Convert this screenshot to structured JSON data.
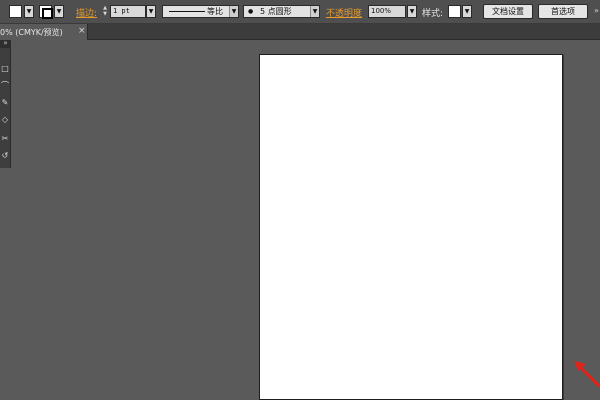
{
  "control_bar": {
    "fill_swatch_color": "#ffffff",
    "stroke_swatch_color": "#ffffff",
    "stroke_label": "描边:",
    "stroke_weight_value": "1 pt",
    "stroke_profile_label": "等比",
    "brush_value": "5 点圆形",
    "brush_dot": "●",
    "opacity_label": "不透明度",
    "opacity_value": "100%",
    "style_label": "样式:",
    "doc_setup_button": "文档设置",
    "preferences_button": "首选项",
    "overflow_glyph": "»",
    "dropdown_glyph": "▼"
  },
  "tab_bar": {
    "document_tab_label": "0% (CMYK/预览)",
    "close_glyph": "×"
  },
  "tools_panel": {
    "header_glyph": "»",
    "tool_glyphs": [
      "□",
      "⌒",
      "✎",
      "◇",
      "✂",
      "↺"
    ]
  },
  "colors": {
    "canvas_bg": "#5a5a5a",
    "control_bar_bg": "#4f4f4f",
    "accent_orange": "#e79a2e",
    "annotation_red": "#e2231a",
    "artboard": "#ffffff"
  },
  "icons": {
    "spinner": "up-down-arrows-icon",
    "annotation": "red-arrow-icon"
  }
}
